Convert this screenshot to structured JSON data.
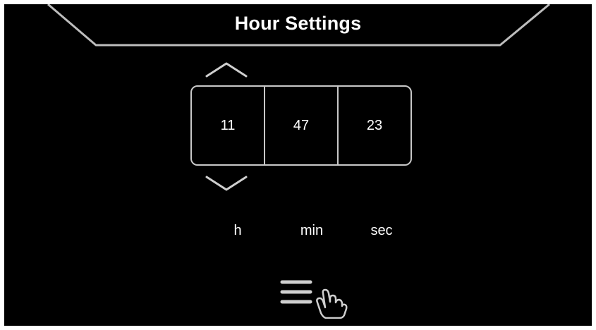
{
  "header": {
    "title": "Hour Settings"
  },
  "time": {
    "hours": "11",
    "minutes": "47",
    "seconds": "23"
  },
  "units": {
    "hours": "h",
    "minutes": "min",
    "seconds": "sec"
  },
  "icons": {
    "increment": "chevron-up-icon",
    "decrement": "chevron-down-icon",
    "menu": "menu-tap-icon"
  },
  "colors": {
    "background": "#000000",
    "foreground": "#ffffff",
    "outline": "#c8c8c8"
  }
}
